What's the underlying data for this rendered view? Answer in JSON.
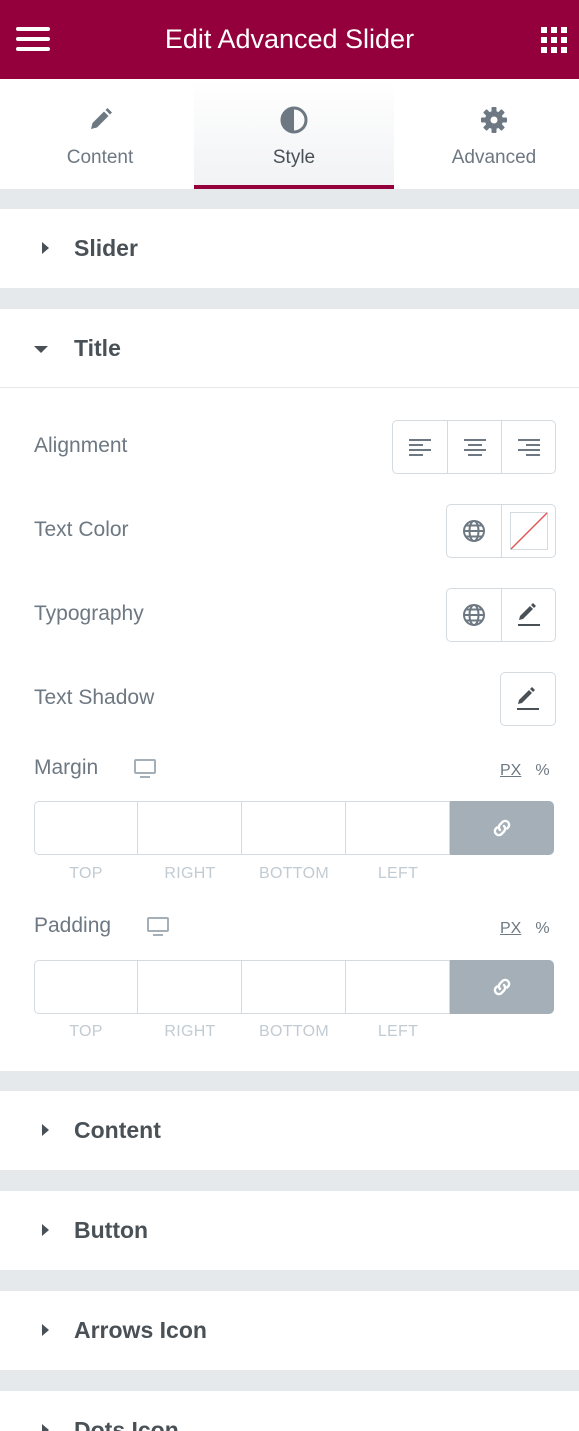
{
  "header": {
    "title": "Edit Advanced Slider",
    "menu_icon": "hamburger-menu-icon",
    "apps_icon": "grid-apps-icon"
  },
  "tabs": [
    {
      "label": "Content",
      "icon": "pencil-icon",
      "active": false
    },
    {
      "label": "Style",
      "icon": "half-circle-contrast-icon",
      "active": true
    },
    {
      "label": "Advanced",
      "icon": "gear-icon",
      "active": false
    }
  ],
  "sections": {
    "slider": "Slider",
    "title": "Title",
    "content": "Content",
    "button": "Button",
    "arrows_icon": "Arrows Icon",
    "dots_icon": "Dots Icon"
  },
  "title_controls": {
    "alignment": "Alignment",
    "text_color": "Text Color",
    "typography": "Typography",
    "text_shadow": "Text Shadow",
    "margin": {
      "label": "Margin",
      "unit_px": "PX",
      "unit_pct": "%",
      "fields": {
        "top": "TOP",
        "right": "RIGHT",
        "bottom": "BOTTOM",
        "left": "LEFT"
      }
    },
    "padding": {
      "label": "Padding",
      "unit_px": "PX",
      "unit_pct": "%",
      "fields": {
        "top": "TOP",
        "right": "RIGHT",
        "bottom": "BOTTOM",
        "left": "LEFT"
      }
    }
  },
  "colors": {
    "brand": "#93003c",
    "panel_bg": "#e6e9ec",
    "text": "#495157",
    "muted": "#6d7882",
    "link_button": "#a4afb7"
  }
}
